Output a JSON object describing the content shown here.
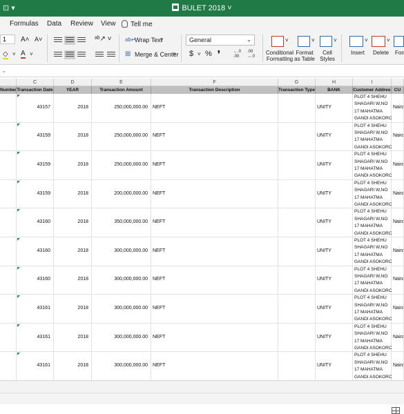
{
  "window": {
    "title": "BULET 2018",
    "quick_access": "⊡ ▾"
  },
  "tabs": {
    "items": [
      "Formulas",
      "Data",
      "Review",
      "View"
    ],
    "tell_me": "Tell me"
  },
  "ribbon": {
    "font_size": "1",
    "grow_font": "A˄",
    "shrink_font": "A˅",
    "wrap_text": "Wrap Text",
    "merge_center": "Merge & Center",
    "number_format": "General",
    "currency": "$",
    "percent": "%",
    "comma": "❜",
    "inc_decimal": "←.0 .00",
    "dec_decimal": ".00 →.0",
    "conditional_formatting": [
      "Conditional",
      "Formatting"
    ],
    "format_as_table": [
      "Format",
      "as Table"
    ],
    "cell_styles": [
      "Cell",
      "Styles"
    ],
    "insert": "Insert",
    "delete": "Delete",
    "format": "Forr"
  },
  "sheet": {
    "columns": [
      "C",
      "D",
      "E",
      "F",
      "G",
      "H",
      "I"
    ],
    "headers": [
      "Number",
      "Transaction Date",
      "YEAR",
      "Transaction Amount",
      "Transaction Description",
      "Transaction Type",
      "BANK",
      "Customer Address",
      "CU"
    ],
    "rows": [
      {
        "date": "43157",
        "year": "2018",
        "amount": "250,000,000.00",
        "desc": "NEFT",
        "bank": "UNITY"
      },
      {
        "date": "43159",
        "year": "2018",
        "amount": "250,000,000.00",
        "desc": "NEFT",
        "bank": "UNITY"
      },
      {
        "date": "43159",
        "year": "2018",
        "amount": "250,000,000.00",
        "desc": "NEFT",
        "bank": "UNITY"
      },
      {
        "date": "43159",
        "year": "2018",
        "amount": "200,000,000.00",
        "desc": "NEFT",
        "bank": "UNITY"
      },
      {
        "date": "43160",
        "year": "2018",
        "amount": "350,000,000.00",
        "desc": "NEFT",
        "bank": "UNITY"
      },
      {
        "date": "43160",
        "year": "2018",
        "amount": "300,000,000.00",
        "desc": "NEFT",
        "bank": "UNITY"
      },
      {
        "date": "43160",
        "year": "2018",
        "amount": "300,000,000.00",
        "desc": "NEFT",
        "bank": "UNITY"
      },
      {
        "date": "43161",
        "year": "2018",
        "amount": "300,000,000.00",
        "desc": "NEFT",
        "bank": "UNITY"
      },
      {
        "date": "43161",
        "year": "2018",
        "amount": "300,000,000.00",
        "desc": "NEFT",
        "bank": "UNITY"
      },
      {
        "date": "43161",
        "year": "2018",
        "amount": "300,000,000.00",
        "desc": "NEFT",
        "bank": "UNITY"
      }
    ],
    "address_lines": [
      "PLOT 4   SHEHU",
      "SHAGARI  W,NO",
      "17 MAHATMA",
      "GANDI ASOKORO"
    ],
    "currency_label": "Naira"
  }
}
